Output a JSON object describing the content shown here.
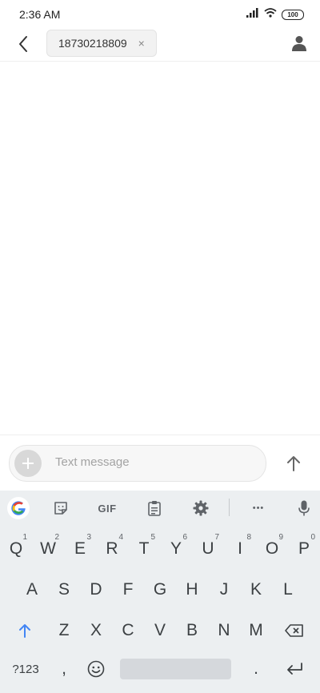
{
  "status_bar": {
    "time": "2:36 AM",
    "battery": "100"
  },
  "header": {
    "recipient": "18730218809",
    "chip_close": "×"
  },
  "compose": {
    "placeholder": "Text message"
  },
  "keyboard": {
    "toolbar": {
      "gif": "GIF",
      "more": "•••"
    },
    "row1": [
      {
        "label": "Q",
        "num": "1"
      },
      {
        "label": "W",
        "num": "2"
      },
      {
        "label": "E",
        "num": "3"
      },
      {
        "label": "R",
        "num": "4"
      },
      {
        "label": "T",
        "num": "5"
      },
      {
        "label": "Y",
        "num": "6"
      },
      {
        "label": "U",
        "num": "7"
      },
      {
        "label": "I",
        "num": "8"
      },
      {
        "label": "O",
        "num": "9"
      },
      {
        "label": "P",
        "num": "0"
      }
    ],
    "row2": [
      "A",
      "S",
      "D",
      "F",
      "G",
      "H",
      "J",
      "K",
      "L"
    ],
    "row3": [
      "Z",
      "X",
      "C",
      "V",
      "B",
      "N",
      "M"
    ],
    "bottom": {
      "symbols": "?123",
      "comma": ",",
      "period": "."
    }
  },
  "colors": {
    "accent_shift": "#4285f4",
    "keyboard_bg": "#eceff1"
  }
}
